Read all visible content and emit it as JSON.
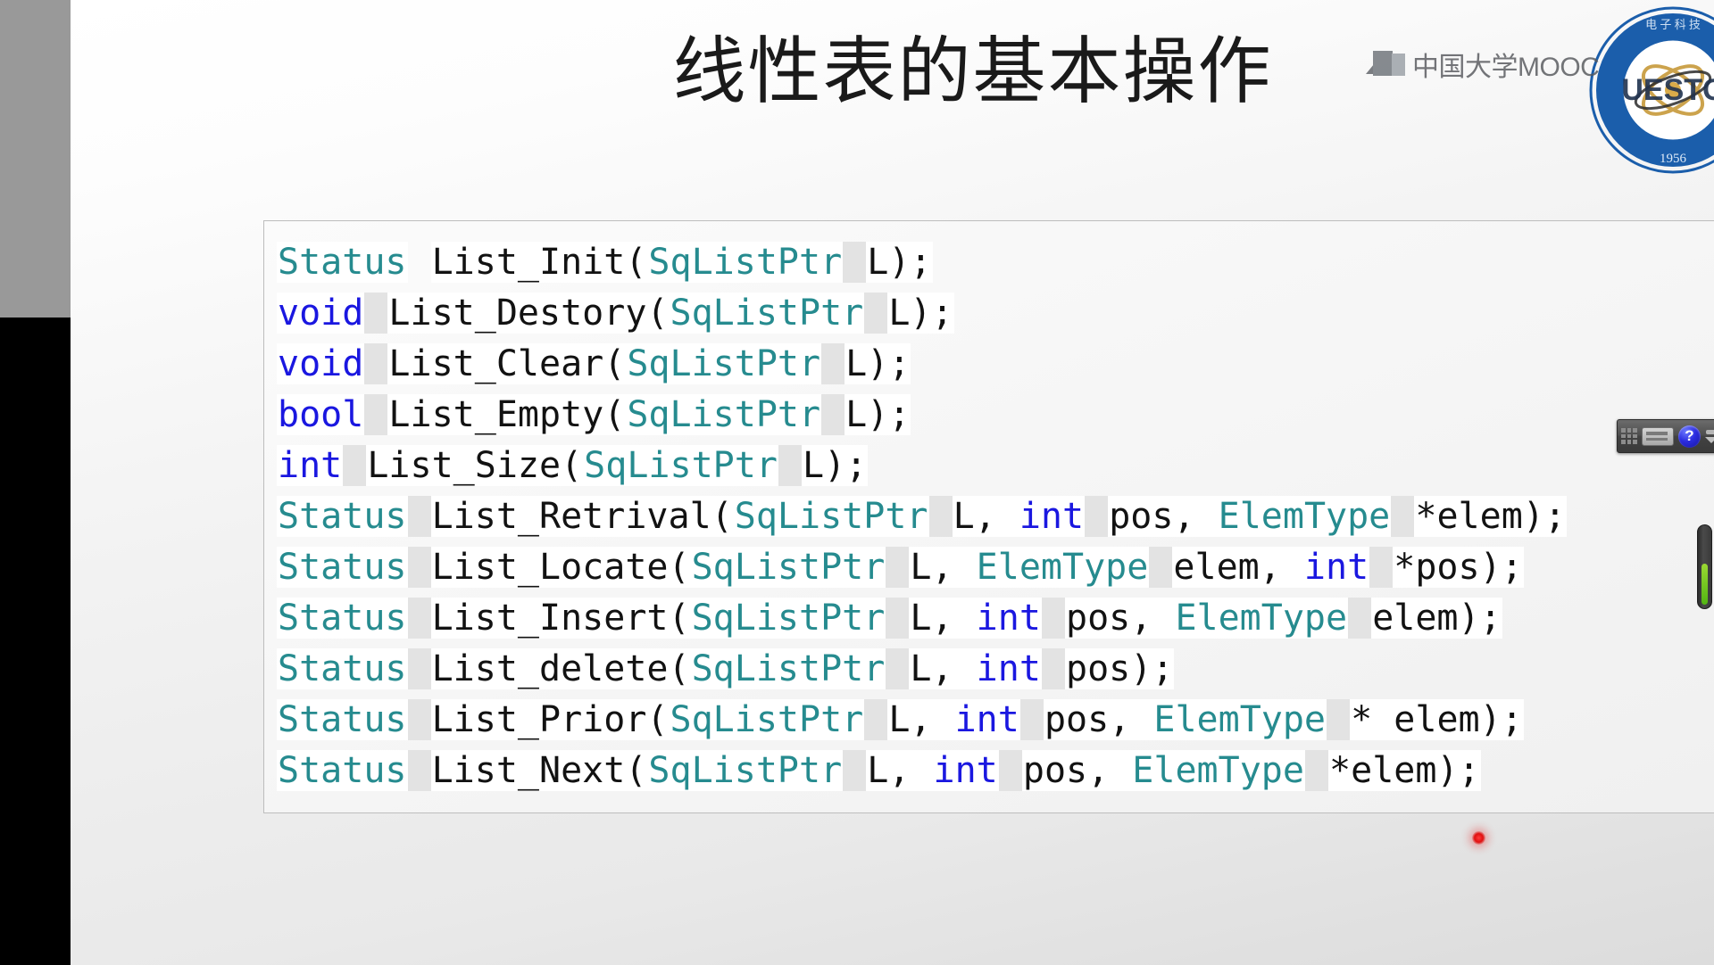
{
  "slide": {
    "title": "线性表的基本操作",
    "watermark_text": "中国大学MOOC",
    "logo_year": "1956",
    "logo_acronym": "UESTC",
    "logo_ring_text": "电子科技大学",
    "code_lines": [
      {
        "text": "Status List_Init(SqListPtr L);",
        "tokens": [
          {
            "t": "Status",
            "c": "type",
            "hl": "white"
          },
          {
            "t": " ",
            "c": "plain",
            "hl": "none"
          },
          {
            "t": "List_Init(",
            "c": "plain",
            "hl": "white"
          },
          {
            "t": "SqListPtr",
            "c": "type",
            "hl": "white"
          },
          {
            "t": " ",
            "c": "plain",
            "hl": "dim"
          },
          {
            "t": "L);",
            "c": "plain",
            "hl": "white"
          }
        ]
      },
      {
        "text": "void List_Destory(SqListPtr L);",
        "tokens": [
          {
            "t": "void",
            "c": "kw",
            "hl": "white"
          },
          {
            "t": " ",
            "c": "plain",
            "hl": "dim"
          },
          {
            "t": "List_Destory(",
            "c": "plain",
            "hl": "white"
          },
          {
            "t": "SqListPtr",
            "c": "type",
            "hl": "white"
          },
          {
            "t": " ",
            "c": "plain",
            "hl": "dim"
          },
          {
            "t": "L);",
            "c": "plain",
            "hl": "white"
          }
        ]
      },
      {
        "text": "void List_Clear(SqListPtr L);",
        "tokens": [
          {
            "t": "void",
            "c": "kw",
            "hl": "white"
          },
          {
            "t": " ",
            "c": "plain",
            "hl": "dim"
          },
          {
            "t": "List_Clear(",
            "c": "plain",
            "hl": "white"
          },
          {
            "t": "SqListPtr",
            "c": "type",
            "hl": "white"
          },
          {
            "t": " ",
            "c": "plain",
            "hl": "dim"
          },
          {
            "t": "L);",
            "c": "plain",
            "hl": "white"
          }
        ]
      },
      {
        "text": "bool List_Empty(SqListPtr L);",
        "tokens": [
          {
            "t": "bool",
            "c": "kw",
            "hl": "white"
          },
          {
            "t": " ",
            "c": "plain",
            "hl": "dim"
          },
          {
            "t": "List_Empty(",
            "c": "plain",
            "hl": "white"
          },
          {
            "t": "SqListPtr",
            "c": "type",
            "hl": "white"
          },
          {
            "t": " ",
            "c": "plain",
            "hl": "dim"
          },
          {
            "t": "L);",
            "c": "plain",
            "hl": "white"
          }
        ]
      },
      {
        "text": "int List_Size(SqListPtr L);",
        "tokens": [
          {
            "t": "int",
            "c": "kw",
            "hl": "white"
          },
          {
            "t": " ",
            "c": "plain",
            "hl": "dim"
          },
          {
            "t": "List_Size(",
            "c": "plain",
            "hl": "white"
          },
          {
            "t": "SqListPtr",
            "c": "type",
            "hl": "white"
          },
          {
            "t": " ",
            "c": "plain",
            "hl": "dim"
          },
          {
            "t": "L);",
            "c": "plain",
            "hl": "white"
          }
        ]
      },
      {
        "text": "Status List_Retrival(SqListPtr L, int pos, ElemType *elem);",
        "tokens": [
          {
            "t": "Status",
            "c": "type",
            "hl": "white"
          },
          {
            "t": " ",
            "c": "plain",
            "hl": "dim"
          },
          {
            "t": "List_Retrival(",
            "c": "plain",
            "hl": "white"
          },
          {
            "t": "SqListPtr",
            "c": "type",
            "hl": "white"
          },
          {
            "t": " ",
            "c": "plain",
            "hl": "dim"
          },
          {
            "t": "L, ",
            "c": "plain",
            "hl": "white"
          },
          {
            "t": "int",
            "c": "kw",
            "hl": "white"
          },
          {
            "t": " ",
            "c": "plain",
            "hl": "dim"
          },
          {
            "t": "pos, ",
            "c": "plain",
            "hl": "white"
          },
          {
            "t": "ElemType",
            "c": "type",
            "hl": "white"
          },
          {
            "t": " ",
            "c": "plain",
            "hl": "dim"
          },
          {
            "t": "*elem);",
            "c": "plain",
            "hl": "white"
          }
        ]
      },
      {
        "text": "Status List_Locate(SqListPtr L, ElemType elem, int *pos);",
        "tokens": [
          {
            "t": "Status",
            "c": "type",
            "hl": "white"
          },
          {
            "t": " ",
            "c": "plain",
            "hl": "dim"
          },
          {
            "t": "List_Locate(",
            "c": "plain",
            "hl": "white"
          },
          {
            "t": "SqListPtr",
            "c": "type",
            "hl": "white"
          },
          {
            "t": " ",
            "c": "plain",
            "hl": "dim"
          },
          {
            "t": "L, ",
            "c": "plain",
            "hl": "white"
          },
          {
            "t": "ElemType",
            "c": "type",
            "hl": "white"
          },
          {
            "t": " ",
            "c": "plain",
            "hl": "dim"
          },
          {
            "t": "elem, ",
            "c": "plain",
            "hl": "white"
          },
          {
            "t": "int",
            "c": "kw",
            "hl": "white"
          },
          {
            "t": " ",
            "c": "plain",
            "hl": "dim"
          },
          {
            "t": "*pos);",
            "c": "plain",
            "hl": "white"
          }
        ]
      },
      {
        "text": "Status List_Insert(SqListPtr L, int pos, ElemType elem);",
        "tokens": [
          {
            "t": "Status",
            "c": "type",
            "hl": "white"
          },
          {
            "t": " ",
            "c": "plain",
            "hl": "dim"
          },
          {
            "t": "List_Insert(",
            "c": "plain",
            "hl": "white"
          },
          {
            "t": "SqListPtr",
            "c": "type",
            "hl": "white"
          },
          {
            "t": " ",
            "c": "plain",
            "hl": "dim"
          },
          {
            "t": "L, ",
            "c": "plain",
            "hl": "white"
          },
          {
            "t": "int",
            "c": "kw",
            "hl": "white"
          },
          {
            "t": " ",
            "c": "plain",
            "hl": "dim"
          },
          {
            "t": "pos, ",
            "c": "plain",
            "hl": "white"
          },
          {
            "t": "ElemType",
            "c": "type",
            "hl": "white"
          },
          {
            "t": " ",
            "c": "plain",
            "hl": "dim"
          },
          {
            "t": "elem);",
            "c": "plain",
            "hl": "white"
          }
        ]
      },
      {
        "text": "Status List_delete(SqListPtr L, int pos);",
        "tokens": [
          {
            "t": "Status",
            "c": "type",
            "hl": "white"
          },
          {
            "t": " ",
            "c": "plain",
            "hl": "dim"
          },
          {
            "t": "List_delete(",
            "c": "plain",
            "hl": "white"
          },
          {
            "t": "SqListPtr",
            "c": "type",
            "hl": "white"
          },
          {
            "t": " ",
            "c": "plain",
            "hl": "dim"
          },
          {
            "t": "L, ",
            "c": "plain",
            "hl": "white"
          },
          {
            "t": "int",
            "c": "kw",
            "hl": "white"
          },
          {
            "t": " ",
            "c": "plain",
            "hl": "dim"
          },
          {
            "t": "pos);",
            "c": "plain",
            "hl": "white"
          }
        ]
      },
      {
        "text": "Status List_Prior(SqListPtr L, int pos, ElemType * elem);",
        "tokens": [
          {
            "t": "Status",
            "c": "type",
            "hl": "white"
          },
          {
            "t": " ",
            "c": "plain",
            "hl": "dim"
          },
          {
            "t": "List_Prior(",
            "c": "plain",
            "hl": "white"
          },
          {
            "t": "SqListPtr",
            "c": "type",
            "hl": "white"
          },
          {
            "t": " ",
            "c": "plain",
            "hl": "dim"
          },
          {
            "t": "L, ",
            "c": "plain",
            "hl": "white"
          },
          {
            "t": "int",
            "c": "kw",
            "hl": "white"
          },
          {
            "t": " ",
            "c": "plain",
            "hl": "dim"
          },
          {
            "t": "pos, ",
            "c": "plain",
            "hl": "white"
          },
          {
            "t": "ElemType",
            "c": "type",
            "hl": "white"
          },
          {
            "t": " ",
            "c": "plain",
            "hl": "dim"
          },
          {
            "t": "* elem);",
            "c": "plain",
            "hl": "white"
          }
        ]
      },
      {
        "text": "Status List_Next(SqListPtr L, int pos, ElemType *elem);",
        "tokens": [
          {
            "t": "Status",
            "c": "type",
            "hl": "white"
          },
          {
            "t": " ",
            "c": "plain",
            "hl": "dim"
          },
          {
            "t": "List_Next(",
            "c": "plain",
            "hl": "white"
          },
          {
            "t": "SqListPtr",
            "c": "type",
            "hl": "white"
          },
          {
            "t": " ",
            "c": "plain",
            "hl": "dim"
          },
          {
            "t": "L, ",
            "c": "plain",
            "hl": "white"
          },
          {
            "t": "int",
            "c": "kw",
            "hl": "white"
          },
          {
            "t": " ",
            "c": "plain",
            "hl": "dim"
          },
          {
            "t": "pos, ",
            "c": "plain",
            "hl": "white"
          },
          {
            "t": "ElemType",
            "c": "type",
            "hl": "white"
          },
          {
            "t": " ",
            "c": "plain",
            "hl": "dim"
          },
          {
            "t": "*elem);",
            "c": "plain",
            "hl": "white"
          }
        ]
      }
    ]
  },
  "overlay": {
    "help_label": "?",
    "toolbar_icons": [
      "grid-icon",
      "keyboard-icon",
      "help-icon",
      "expand-collapse-arrows"
    ],
    "laser_pointer": "red-laser-dot",
    "volume_slider": "vertical-slider"
  },
  "colors": {
    "keyword_blue": "#1a17e0",
    "type_teal": "#268b8f",
    "text_black": "#121212",
    "logo_blue": "#1b5eab",
    "laser_red": "#e01010",
    "slider_green": "#6fc41a"
  }
}
